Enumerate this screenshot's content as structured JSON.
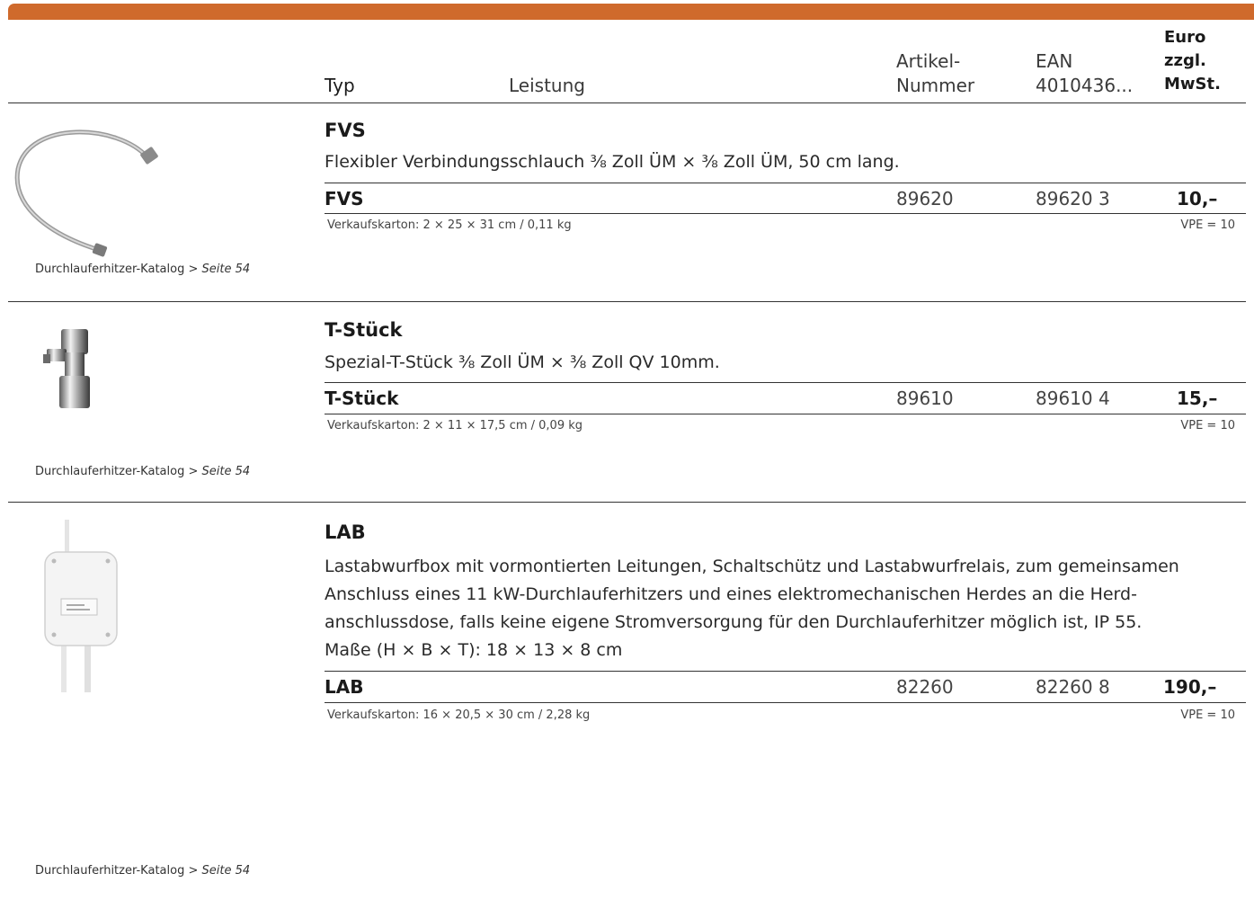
{
  "header": {
    "typ": "Typ",
    "leistung": "Leistung",
    "artikel": "Artikel-\nNummer",
    "ean": "EAN\n4010436...",
    "euro": "Euro\nzzgl.\nMwSt."
  },
  "products": [
    {
      "title": "FVS",
      "description": "Flexibler Verbindungsschlauch ⅜ Zoll ÜM × ⅜ Zoll ÜM, 50 cm lang.",
      "typ": "FVS",
      "artikel": "89620",
      "ean": "89620 3",
      "price": "10,–",
      "karton": "Verkaufskarton: 2 × 25 × 31 cm / 0,11 kg",
      "vpe": "VPE = 10",
      "catalog": "Durchlauferhitzer-Katalog >",
      "page": "Seite 54",
      "image": "flexible-hose"
    },
    {
      "title": "T-Stück",
      "description": "Spezial-T-Stück ⅜ Zoll ÜM × ⅜ Zoll QV 10mm.",
      "typ": "T-Stück",
      "artikel": "89610",
      "ean": "89610 4",
      "price": "15,–",
      "karton": "Verkaufskarton: 2 × 11 × 17,5 cm / 0,09 kg",
      "vpe": "VPE = 10",
      "catalog": "Durchlauferhitzer-Katalog >",
      "page": "Seite 54",
      "image": "t-fitting"
    },
    {
      "title": "LAB",
      "description_lines": [
        "Lastabwurfbox mit vormontierten Leitungen, Schaltschütz und Lastabwurfrelais, zum gemeinsamen",
        "Anschluss eines 11 kW-Durchlauferhitzers und eines elektromechanischen Herdes an die Herd-",
        "anschlussdose, falls keine eigene Stromversorgung für den Durchlauferhitzer möglich ist, IP 55.",
        "Maße (H × B × T): 18 × 13 × 8 cm"
      ],
      "typ": "LAB",
      "artikel": "82260",
      "ean": "82260 8",
      "price": "190,–",
      "karton": "Verkaufskarton: 16 × 20,5 × 30 cm / 2,28 kg",
      "vpe": "VPE = 10",
      "catalog": "Durchlauferhitzer-Katalog >",
      "page": "Seite 54",
      "image": "load-shedding-box"
    }
  ],
  "colors": {
    "accent": "#cf6a2c",
    "text": "#1a1a1a"
  }
}
